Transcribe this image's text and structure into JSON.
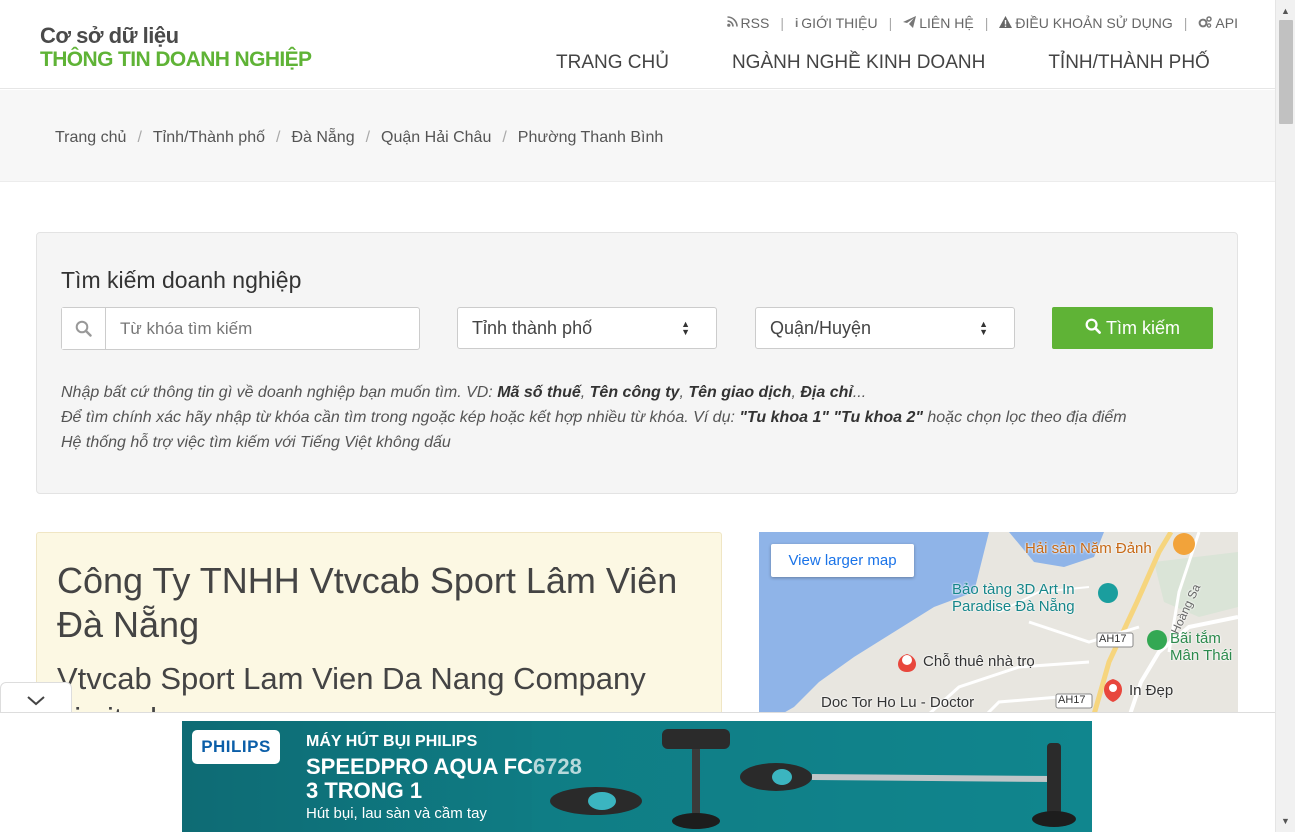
{
  "logo": {
    "line1": "Cơ sở dữ liệu",
    "line2": "THÔNG TIN DOANH NGHIỆP"
  },
  "toplinks": [
    {
      "icon": "rss-icon",
      "label": "RSS"
    },
    {
      "icon": "info-icon",
      "label": "GIỚI THIỆU"
    },
    {
      "icon": "send-icon",
      "label": "LIÊN HỆ"
    },
    {
      "icon": "warning-icon",
      "label": "ĐIỀU KHOẢN SỬ DỤNG"
    },
    {
      "icon": "cogs-icon",
      "label": "API"
    }
  ],
  "nav": [
    "TRANG CHỦ",
    "NGÀNH NGHỀ KINH DOANH",
    "TỈNH/THÀNH PHỐ"
  ],
  "breadcrumb": [
    "Trang chủ",
    "Tỉnh/Thành phố",
    "Đà Nẵng",
    "Quận Hải Châu",
    "Phường Thanh Bình"
  ],
  "search": {
    "title": "Tìm kiếm doanh nghiệp",
    "keyword_placeholder": "Từ khóa tìm kiếm",
    "province_selected": "Tỉnh thành phố",
    "district_selected": "Quận/Huyện",
    "button": "Tìm kiếm",
    "hint1_prefix": "Nhập bất cứ thông tin gì về doanh nghiệp bạn muốn tìm. VD: ",
    "hint1_b1": "Mã số thuế",
    "hint1_b2": "Tên công ty",
    "hint1_b3": "Tên giao dịch",
    "hint1_b4": "Địa chỉ",
    "hint1_suffix": "...",
    "hint2_prefix": "Để tìm chính xác hãy nhập từ khóa cần tìm trong ngoặc kép hoặc kết hợp nhiều từ khóa. Ví dụ: ",
    "hint2_b1": "\"Tu khoa 1\"",
    "hint2_b2": "\"Tu khoa 2\"",
    "hint2_suffix": " hoặc chọn lọc theo địa điểm",
    "hint3": "Hệ thống hỗ trợ việc tìm kiếm với Tiếng Việt không dấu"
  },
  "company": {
    "name_vi": "Công Ty TNHH Vtvcab Sport Lâm Viên Đà Nẵng",
    "name_en": "Vtvcab Sport Lam Vien Da Nang Company Limited"
  },
  "map": {
    "button": "View larger map",
    "labels": [
      "Hải sản Năm Đảnh",
      "Bảo tàng 3D Art In Paradise Đà Nẵng",
      "Chỗ thuê nhà trọ",
      "Doc Tor Ho Lu - Doctor",
      "In Đẹp",
      "Bãi tắm Mân Thái",
      "AH17",
      "AH17",
      "Hoàng Sa"
    ]
  },
  "ad": {
    "brand": "PHILIPS",
    "line1": "MÁY HÚT BỤI PHILIPS",
    "line2": "SPEEDPRO AQUA FC6728",
    "line3": "3 TRONG 1",
    "line4": "Hút bụi, lau sàn và cầm tay"
  },
  "colors": {
    "accent": "#5fb336",
    "company_bg": "#fcf8e3",
    "ad_bg": "#0f7c84"
  }
}
